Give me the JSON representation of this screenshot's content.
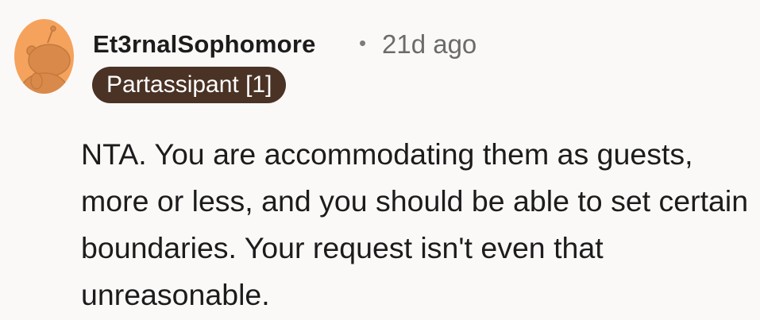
{
  "comment": {
    "author": "Et3rnalSophomore",
    "separator": "•",
    "timestamp": "21d ago",
    "flair": "Partassipant [1]",
    "body": "NTA. You are accommodating them as guests, more or less, and you should be able to set certain boundaries. Your request isn't even that unreasonable.",
    "avatar_icon": "snoo-avatar-icon"
  },
  "colors": {
    "background": "#fbf9f8",
    "avatar_bg": "#f5a25d",
    "flair_bg": "#4a3225",
    "username": "#1c1c1c",
    "meta": "#6b6b6b"
  }
}
